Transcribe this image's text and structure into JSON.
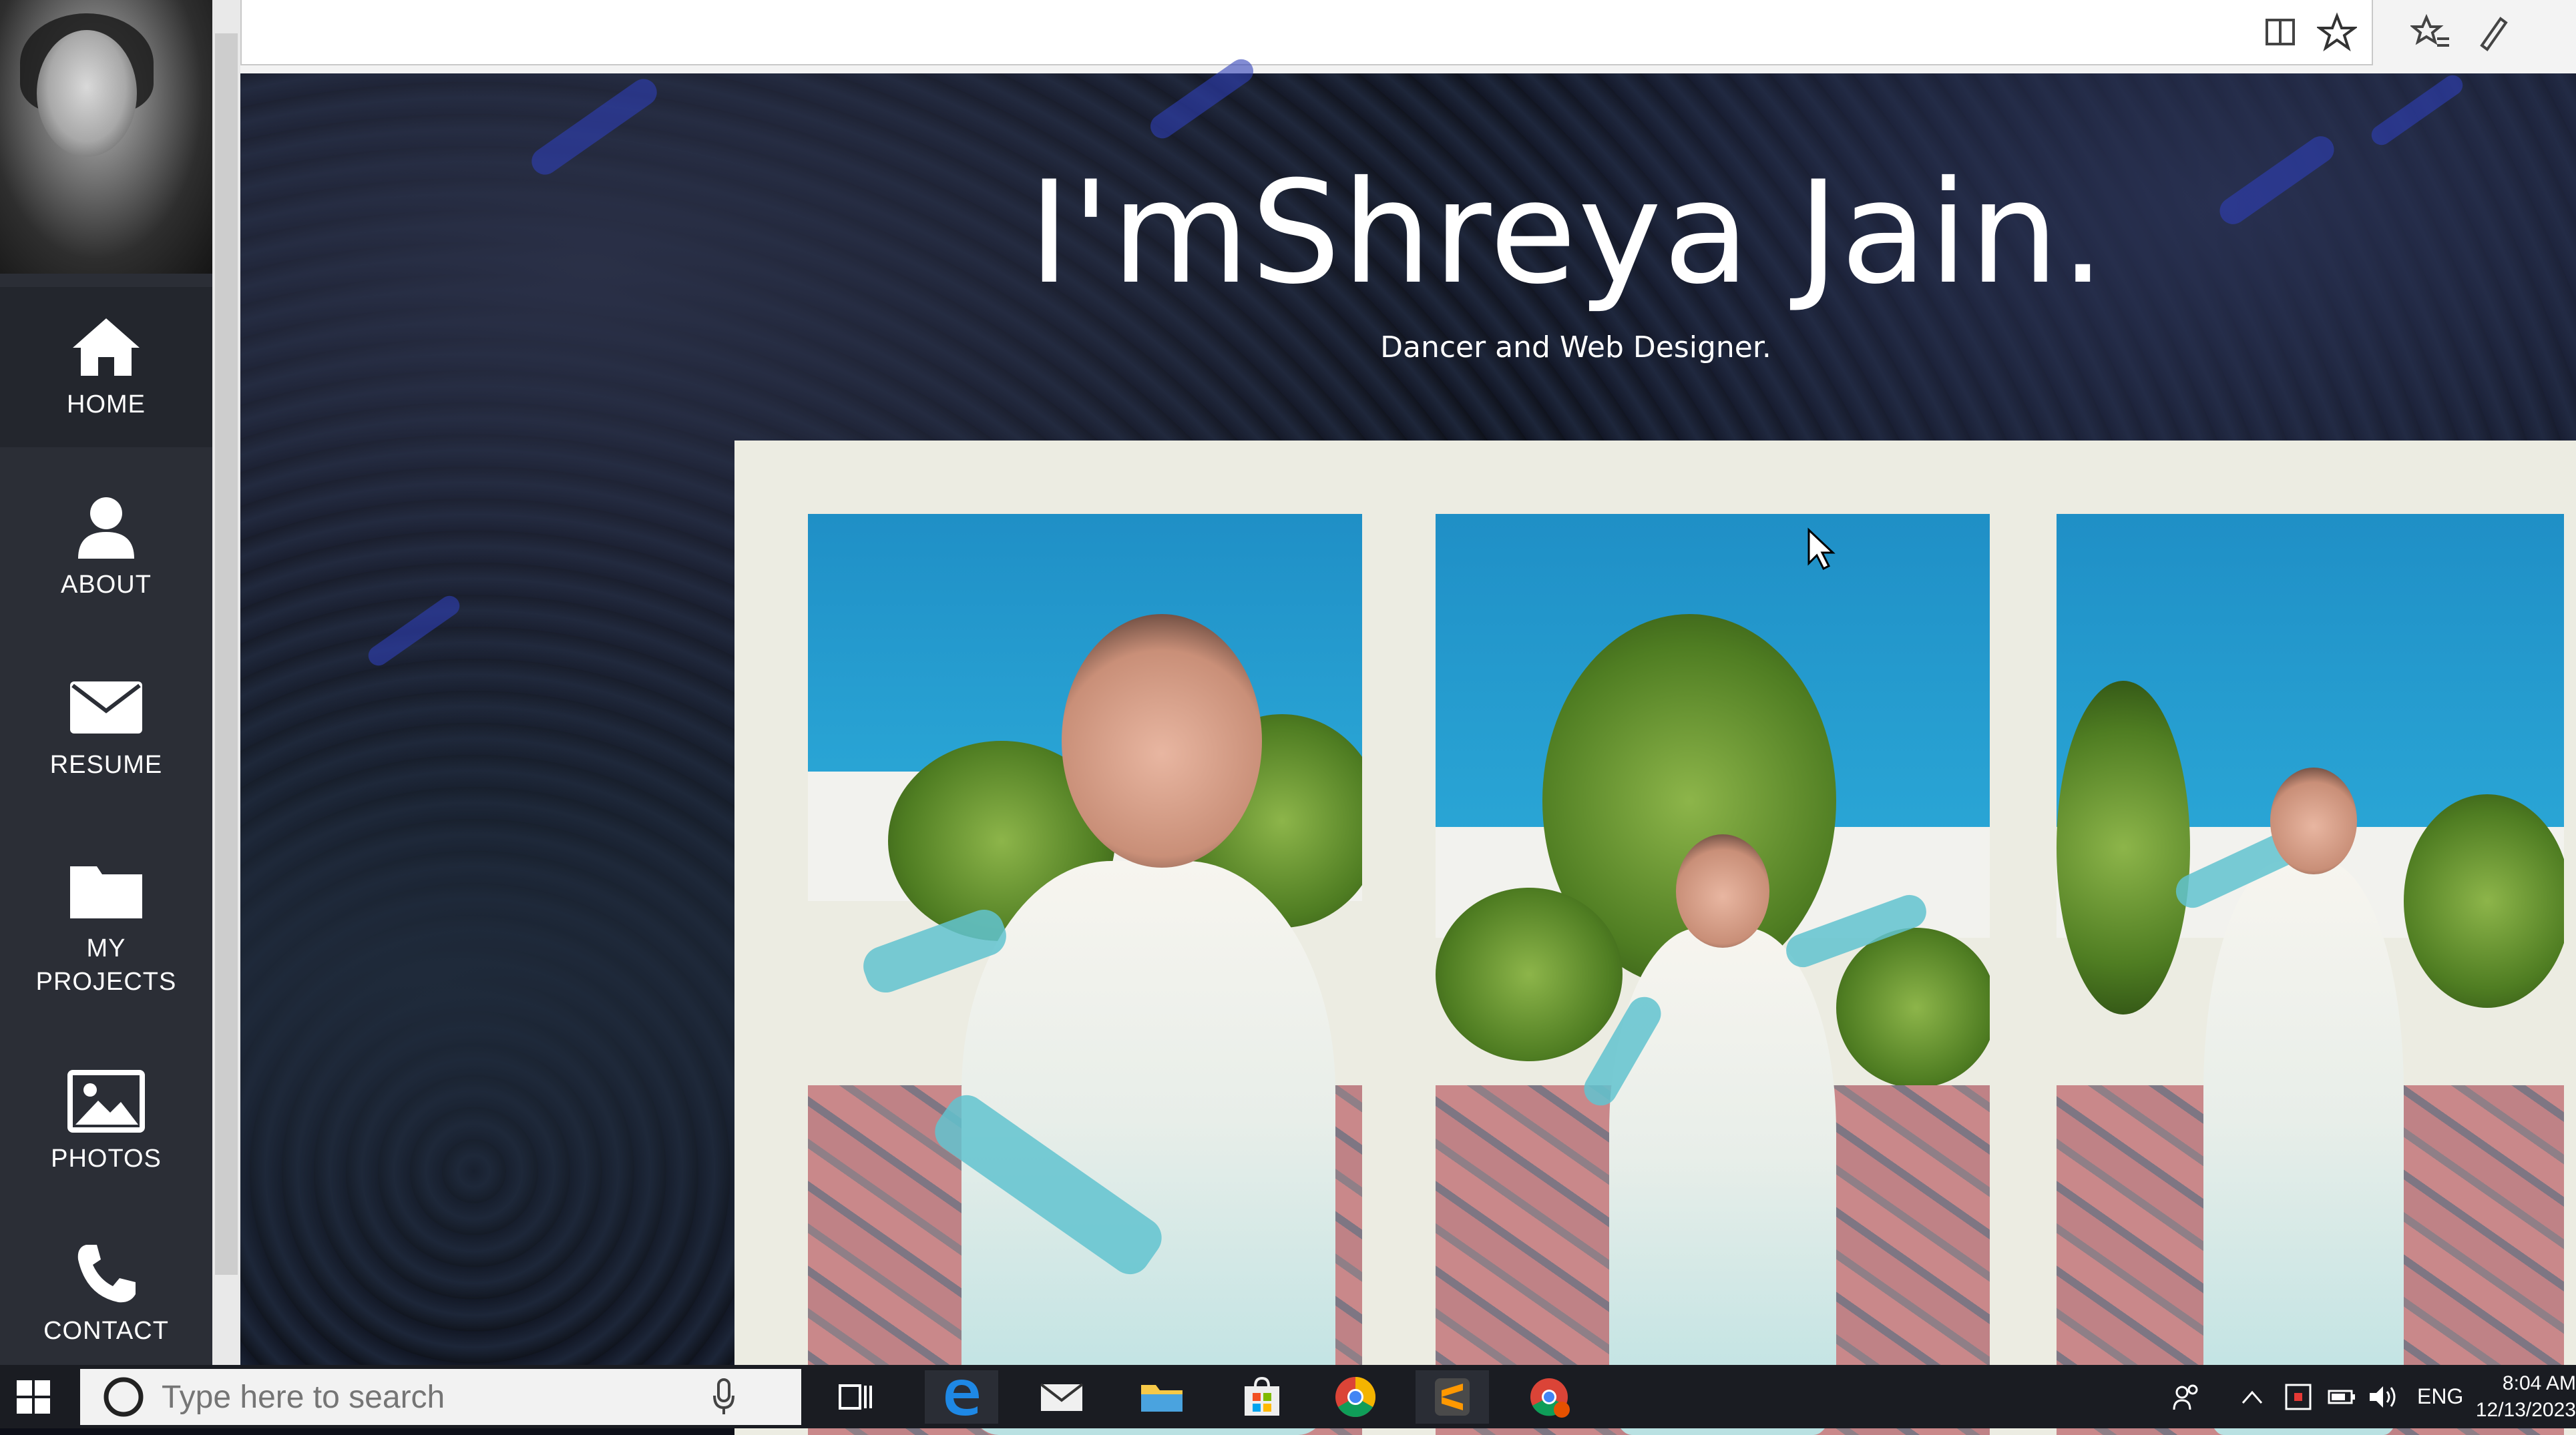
{
  "hero": {
    "title": "I'mShreya Jain.",
    "subtitle": "Dancer and Web Designer."
  },
  "sidebar": {
    "items": [
      {
        "label": "HOME",
        "icon": "home-icon"
      },
      {
        "label": "ABOUT",
        "icon": "user-icon"
      },
      {
        "label": "RESUME",
        "icon": "envelope-icon"
      },
      {
        "label": "MY\nPROJECTS",
        "icon": "folder-icon"
      },
      {
        "label": "PHOTOS",
        "icon": "image-icon"
      },
      {
        "label": "CONTACT",
        "icon": "phone-icon"
      }
    ]
  },
  "taskbar": {
    "search_placeholder": "Type here to search",
    "language": "ENG",
    "time": "8:04 AM",
    "date": "12/13/2023",
    "apps": [
      "task-view-icon",
      "edge-icon",
      "mail-icon",
      "file-explorer-icon",
      "store-icon",
      "chrome-icon",
      "sublime-text-icon",
      "chrome-profile-icon"
    ]
  },
  "colors": {
    "sidebar_bg": "#2b2e36",
    "hero_bg": "#111522",
    "gallery_bg": "#ecece2",
    "taskbar_bg": "#1a1c22"
  }
}
